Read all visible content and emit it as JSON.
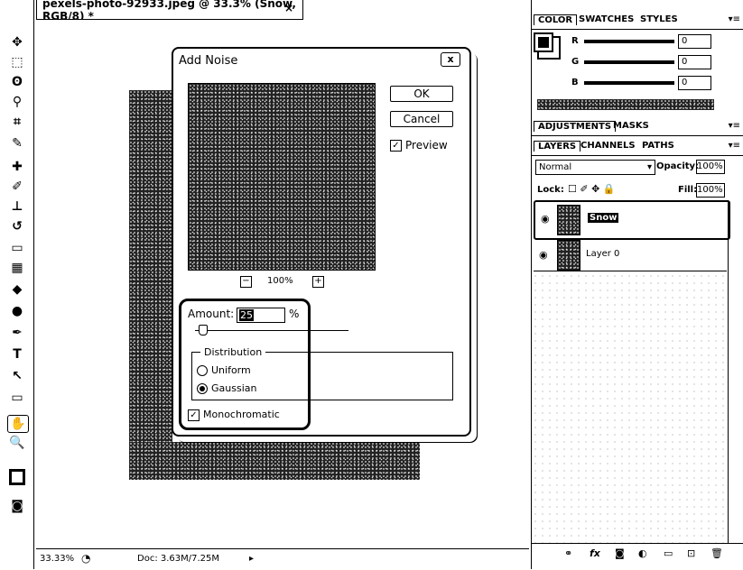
{
  "document": {
    "tab_title": "pexels-photo-92933.jpeg @ 33.3% (Snow, RGB/8) *",
    "close": "×"
  },
  "toolbar": {
    "tools": [
      "move-icon",
      "marquee-icon",
      "lasso-icon",
      "quick-select-icon",
      "crop-icon",
      "eyedropper-icon",
      "healing-icon",
      "brush-icon",
      "stamp-icon",
      "history-brush-icon",
      "eraser-icon",
      "gradient-icon",
      "blur-icon",
      "dodge-icon",
      "pen-icon",
      "type-icon",
      "path-select-icon",
      "shape-icon",
      "hand-icon",
      "zoom-icon"
    ],
    "glyphs": [
      "✥",
      "⬚",
      "ʘ",
      "⚲",
      "⌗",
      "✎",
      "✚",
      "✐",
      "⊥",
      "↺",
      "▭",
      "▦",
      "◆",
      "●",
      "✒",
      "T",
      "↖",
      "▭",
      "✋",
      "🔍"
    ]
  },
  "dialog": {
    "title": "Add Noise",
    "close": "x",
    "ok": "OK",
    "cancel": "Cancel",
    "preview_label": "Preview",
    "preview_checked": true,
    "zoom_level": "100%",
    "zoom_out": "−",
    "zoom_in": "+",
    "amount_label": "Amount:",
    "amount_value": "25",
    "amount_unit": "%",
    "distribution_label": "Distribution",
    "uniform_label": "Uniform",
    "gaussian_label": "Gaussian",
    "selected_distribution": "Gaussian",
    "monochromatic_label": "Monochromatic",
    "monochromatic_checked": true
  },
  "status": {
    "zoom": "33.33%",
    "doc": "Doc: 3.63M/7.25M"
  },
  "color_panel": {
    "tabs": [
      "COLOR",
      "SWATCHES",
      "STYLES"
    ],
    "channels": [
      {
        "label": "R",
        "value": "0"
      },
      {
        "label": "G",
        "value": "0"
      },
      {
        "label": "B",
        "value": "0"
      }
    ]
  },
  "adjustments_panel": {
    "tabs": [
      "ADJUSTMENTS",
      "MASKS"
    ]
  },
  "layers_panel": {
    "tabs": [
      "LAYERS",
      "CHANNELS",
      "PATHS"
    ],
    "blend_mode": "Normal",
    "opacity_label": "Opacity:",
    "opacity_value": "100%",
    "lock_label": "Lock:",
    "fill_label": "Fill:",
    "fill_value": "100%",
    "layers": [
      {
        "name": "Snow",
        "selected": true
      },
      {
        "name": "Layer 0",
        "selected": false
      }
    ],
    "footer_icons": [
      "link-icon",
      "fx-icon",
      "mask-icon",
      "adjustment-icon",
      "group-icon",
      "new-layer-icon",
      "delete-icon"
    ],
    "footer_glyphs": [
      "⚭",
      "fx",
      "◙",
      "◐",
      "▭",
      "⊡",
      "🗑"
    ]
  }
}
